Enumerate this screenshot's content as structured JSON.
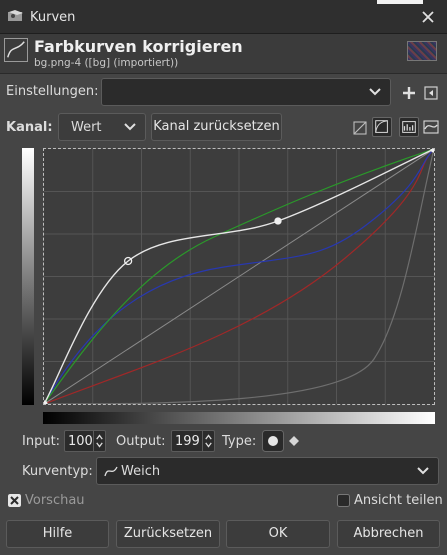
{
  "window": {
    "title": "Kurven"
  },
  "header": {
    "title": "Farbkurven korrigieren",
    "subtitle": "bg.png-4 ([bg] (importiert))"
  },
  "settings": {
    "label": "Einstellungen:",
    "value": ""
  },
  "channel": {
    "label": "Kanal:",
    "value": "Wert",
    "reset_label": "Kanal zurücksetzen"
  },
  "point": {
    "input_label": "Input:",
    "input_value": "100",
    "output_label": "Output:",
    "output_value": "199",
    "type_label": "Type:"
  },
  "curve_type": {
    "label": "Kurventyp:",
    "value": "Weich"
  },
  "preview": {
    "label": "Vorschau",
    "checked": true
  },
  "split_view": {
    "label": "Ansicht teilen",
    "checked": false
  },
  "buttons": {
    "help": "Hilfe",
    "reset": "Zurücksetzen",
    "ok": "OK",
    "cancel": "Abbrechen"
  },
  "curves": {
    "value_points": [
      [
        0,
        0
      ],
      [
        55,
        143
      ],
      [
        153,
        183
      ],
      [
        255,
        255
      ]
    ],
    "colors": {
      "value": "#e6e6e6",
      "red": "#a02828",
      "green": "#2a9a2a",
      "blue": "#2838b0",
      "identity": "#8a8a8a"
    }
  }
}
